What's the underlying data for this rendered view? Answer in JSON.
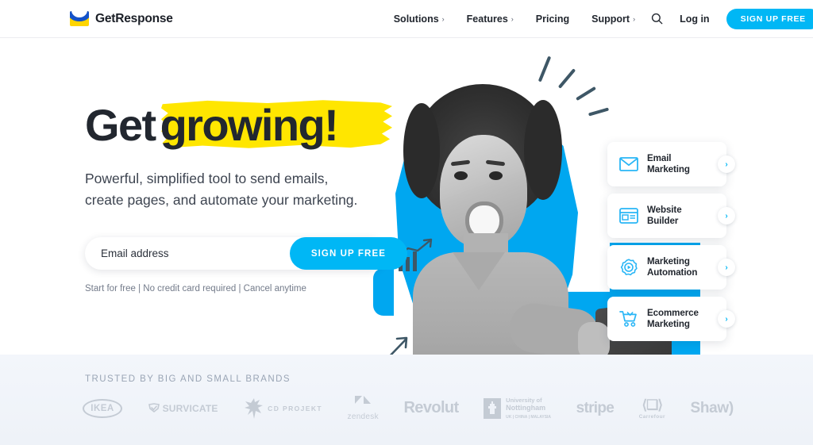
{
  "header": {
    "logo": {
      "text": "GetResponse",
      "icon": "getresponse-envelope-logo"
    },
    "nav": [
      {
        "label": "Solutions",
        "chevron": "›"
      },
      {
        "label": "Features",
        "chevron": "›"
      },
      {
        "label": "Pricing",
        "chevron": ""
      },
      {
        "label": "Support",
        "chevron": "›"
      }
    ],
    "search_icon": "search-icon",
    "login_label": "Log in",
    "signup_label": "SIGN UP FREE"
  },
  "hero": {
    "headline_part1": "Get",
    "headline_part2": "growing!",
    "subhead_line1": "Powerful, simplified tool to send emails,",
    "subhead_line2": "create pages, and automate your marketing.",
    "email_placeholder": "Email address",
    "email_value": "",
    "form_button": "SIGN UP FREE",
    "disclaimer": "Start for free | No credit card required | Cancel anytime"
  },
  "cards": [
    {
      "line1": "Email",
      "line2": "Marketing",
      "icon": "envelope-icon",
      "chevron": "›"
    },
    {
      "line1": "Website",
      "line2": "Builder",
      "icon": "browser-window-icon",
      "chevron": "›"
    },
    {
      "line1": "Marketing",
      "line2": "Automation",
      "icon": "gear-play-icon",
      "chevron": "›"
    },
    {
      "line1": "Ecommerce",
      "line2": "Marketing",
      "icon": "shopping-cart-icon",
      "chevron": "›"
    }
  ],
  "brands": {
    "title": "TRUSTED BY BIG AND SMALL BRANDS",
    "logos": [
      {
        "name": "IKEA",
        "text": "IKEA"
      },
      {
        "name": "Survicate",
        "text": "SURVICATE"
      },
      {
        "name": "CD Projekt",
        "text": "CD PROJEKT"
      },
      {
        "name": "Zendesk",
        "text": "zendesk"
      },
      {
        "name": "Revolut",
        "text": "Revolut"
      },
      {
        "name": "University of Nottingham",
        "text": "University of",
        "text2": "Nottingham",
        "text3": "UK | CHINA | MALAYSIA"
      },
      {
        "name": "Stripe",
        "text": "stripe"
      },
      {
        "name": "Carrefour",
        "text": "Carrefour"
      },
      {
        "name": "Shaw",
        "text": "Shaw)"
      }
    ]
  },
  "colors": {
    "cyan": "#00b7f5",
    "blob_cyan": "#00a7f0",
    "yellow": "#ffe600",
    "ink": "#22272f",
    "brand_gray": "#b4bcc7"
  }
}
